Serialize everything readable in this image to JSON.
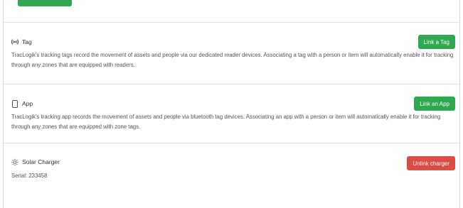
{
  "tag": {
    "title": "Tag",
    "icon": "radio-signal-icon",
    "button_label": "Link a Tag",
    "description": "TracLogik's tracking tags record the movement of assets and people via our dedicated reader devices. Associating a tag with a person or item will automatically enable it for tracking through any zones that are equipped with readers."
  },
  "app": {
    "title": "App",
    "icon": "phone-icon",
    "button_label": "Link an App",
    "description": "TracLogik's tracking app records the movement of assets and people via bluetooth tag devices. Associating an app with a person or item will automatically enable it for tracking through any zones that are equipped with zone tags."
  },
  "charger": {
    "title": "Solar Charger",
    "icon": "sun-icon",
    "button_label": "Unlink charger",
    "serial": "Serial: 233458"
  },
  "colors": {
    "primary_green": "#2fa84f",
    "danger_red": "#dc4d45"
  }
}
